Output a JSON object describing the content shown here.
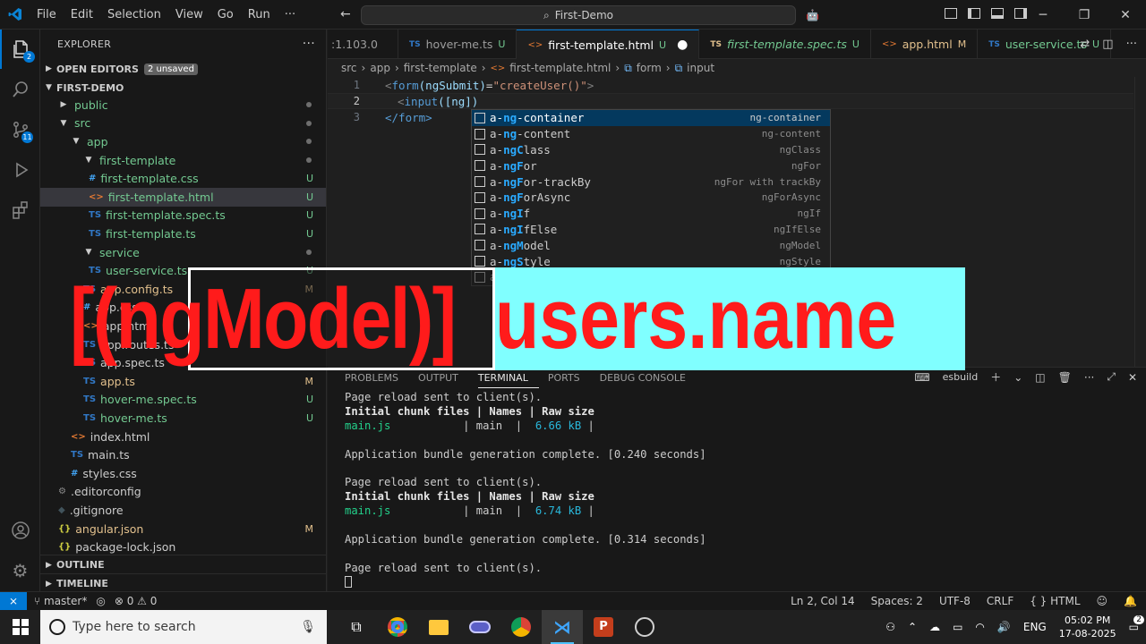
{
  "window": {
    "menu": [
      "File",
      "Edit",
      "Selection",
      "View",
      "Go",
      "Run"
    ],
    "more": "···",
    "search_text": "First-Demo"
  },
  "activity": {
    "explorer_badge": "2",
    "scm_badge": "11"
  },
  "sidebar": {
    "header": "EXPLORER",
    "open_editors": "OPEN EDITORS",
    "unsaved": "2 unsaved",
    "project": "FIRST-DEMO",
    "items": [
      {
        "label": "public",
        "icon": "",
        "status": "",
        "dot": true
      },
      {
        "label": "src",
        "icon": "",
        "status": "",
        "dot": true
      },
      {
        "label": "app",
        "icon": "",
        "status": "",
        "dot": true
      },
      {
        "label": "first-template",
        "icon": "",
        "status": "",
        "dot": true
      },
      {
        "label": "first-template.css",
        "icon": "#",
        "status": "U"
      },
      {
        "label": "first-template.html",
        "icon": "<>",
        "status": "U"
      },
      {
        "label": "first-template.spec.ts",
        "icon": "TS",
        "status": "U"
      },
      {
        "label": "first-template.ts",
        "icon": "TS",
        "status": "U"
      },
      {
        "label": "service",
        "icon": "",
        "status": "",
        "dot": true
      },
      {
        "label": "user-service.ts",
        "icon": "TS",
        "status": "U"
      },
      {
        "label": "app.config.ts",
        "icon": "TS",
        "status": "M"
      },
      {
        "label": "app.css",
        "icon": "#",
        "status": ""
      },
      {
        "label": "app.html",
        "icon": "<>",
        "status": ""
      },
      {
        "label": "app.routes.ts",
        "icon": "TS",
        "status": ""
      },
      {
        "label": "app.spec.ts",
        "icon": "TS",
        "status": ""
      },
      {
        "label": "app.ts",
        "icon": "TS",
        "status": "M"
      },
      {
        "label": "hover-me.spec.ts",
        "icon": "TS",
        "status": "U"
      },
      {
        "label": "hover-me.ts",
        "icon": "TS",
        "status": "U"
      },
      {
        "label": "index.html",
        "icon": "<>",
        "status": ""
      },
      {
        "label": "main.ts",
        "icon": "TS",
        "status": ""
      },
      {
        "label": "styles.css",
        "icon": "#",
        "status": ""
      },
      {
        "label": ".editorconfig",
        "icon": "⚙",
        "status": ""
      },
      {
        "label": ".gitignore",
        "icon": "◆",
        "status": ""
      },
      {
        "label": "angular.json",
        "icon": "{}",
        "status": "M"
      },
      {
        "label": "package-lock.json",
        "icon": "{}",
        "status": ""
      }
    ],
    "outline": "OUTLINE",
    "timeline": "TIMELINE"
  },
  "tabs": [
    {
      "label": ":1.103.0",
      "icon": "",
      "flag": ""
    },
    {
      "label": "hover-me.ts",
      "icon": "TS",
      "flag": "U"
    },
    {
      "label": "first-template.html",
      "icon": "<>",
      "flag": "U"
    },
    {
      "label": "first-template.spec.ts",
      "icon": "TS",
      "flag": "U"
    },
    {
      "label": "app.html",
      "icon": "<>",
      "flag": "M"
    },
    {
      "label": "user-service.ts",
      "icon": "TS",
      "flag": "U"
    }
  ],
  "breadcrumb": [
    "src",
    "app",
    "first-template",
    "first-template.html",
    "form",
    "input"
  ],
  "editor": {
    "line_numbers": [
      "1",
      "2",
      "3"
    ],
    "line1": {
      "open": "<",
      "tag": "form",
      "attr": " (ngSubmit)",
      "eq": "=",
      "val": "\"createUser()\"",
      "close": ">"
    },
    "line2": {
      "open": "<",
      "tag": "input",
      "typed": " ([ng])"
    },
    "line3": {
      "text": "</form>"
    }
  },
  "suggestions": [
    {
      "pre": "a-",
      "hl": "ng",
      "post": "-container",
      "detail": "ng-container"
    },
    {
      "pre": "a-",
      "hl": "ng",
      "post": "-content",
      "detail": "ng-content"
    },
    {
      "pre": "a-",
      "hl": "ngC",
      "post": "lass",
      "detail": "ngClass"
    },
    {
      "pre": "a-",
      "hl": "ngF",
      "post": "or",
      "detail": "ngFor"
    },
    {
      "pre": "a-",
      "hl": "ngF",
      "post": "or-trackBy",
      "detail": "ngFor with trackBy"
    },
    {
      "pre": "a-",
      "hl": "ngF",
      "post": "orAsync",
      "detail": "ngForAsync"
    },
    {
      "pre": "a-",
      "hl": "ngI",
      "post": "f",
      "detail": "ngIf"
    },
    {
      "pre": "a-",
      "hl": "ngI",
      "post": "fElse",
      "detail": "ngIfElse"
    },
    {
      "pre": "a-",
      "hl": "ngM",
      "post": "odel",
      "detail": "ngModel"
    },
    {
      "pre": "a-",
      "hl": "ngS",
      "post": "tyle",
      "detail": "ngStyle"
    },
    {
      "pre": "a",
      "hl": "",
      "post": "",
      "detail": ""
    }
  ],
  "overlay": {
    "left_text": "[(ngModel)]",
    "right_text": "users.name",
    "accent": "#ff1b1b",
    "panel": "#80ffff"
  },
  "panel": {
    "tabs": [
      "PROBLEMS",
      "OUTPUT",
      "TERMINAL",
      "PORTS",
      "DEBUG CONSOLE"
    ],
    "active_tab": "TERMINAL",
    "shell": "esbuild",
    "terminal": {
      "l1": "Page reload sent to client(s).",
      "h1": "Initial chunk files | Names | Raw size",
      "r1_file": "main.js",
      "r1_mid": "           | main  |  ",
      "r1_size": "6.66 kB",
      "r1_end": " |",
      "g1": "Application bundle generation complete. [0.240 seconds]",
      "l2": "Page reload sent to client(s).",
      "h2": "Initial chunk files | Names | Raw size",
      "r2_file": "main.js",
      "r2_mid": "           | main  |  ",
      "r2_size": "6.74 kB",
      "r2_end": " |",
      "g2": "Application bundle generation complete. [0.314 seconds]",
      "l3": "Page reload sent to client(s)."
    }
  },
  "status": {
    "branch": "master*",
    "errors": "⊗ 0 ⚠ 0",
    "position": "Ln 2, Col 14",
    "spaces": "Spaces: 2",
    "encoding": "UTF-8",
    "eol": "CRLF",
    "language": "{ } HTML"
  },
  "taskbar": {
    "search_placeholder": "Type here to search",
    "lang": "ENG",
    "time": "05:02 PM",
    "date": "17-08-2025",
    "notif_count": "2"
  }
}
